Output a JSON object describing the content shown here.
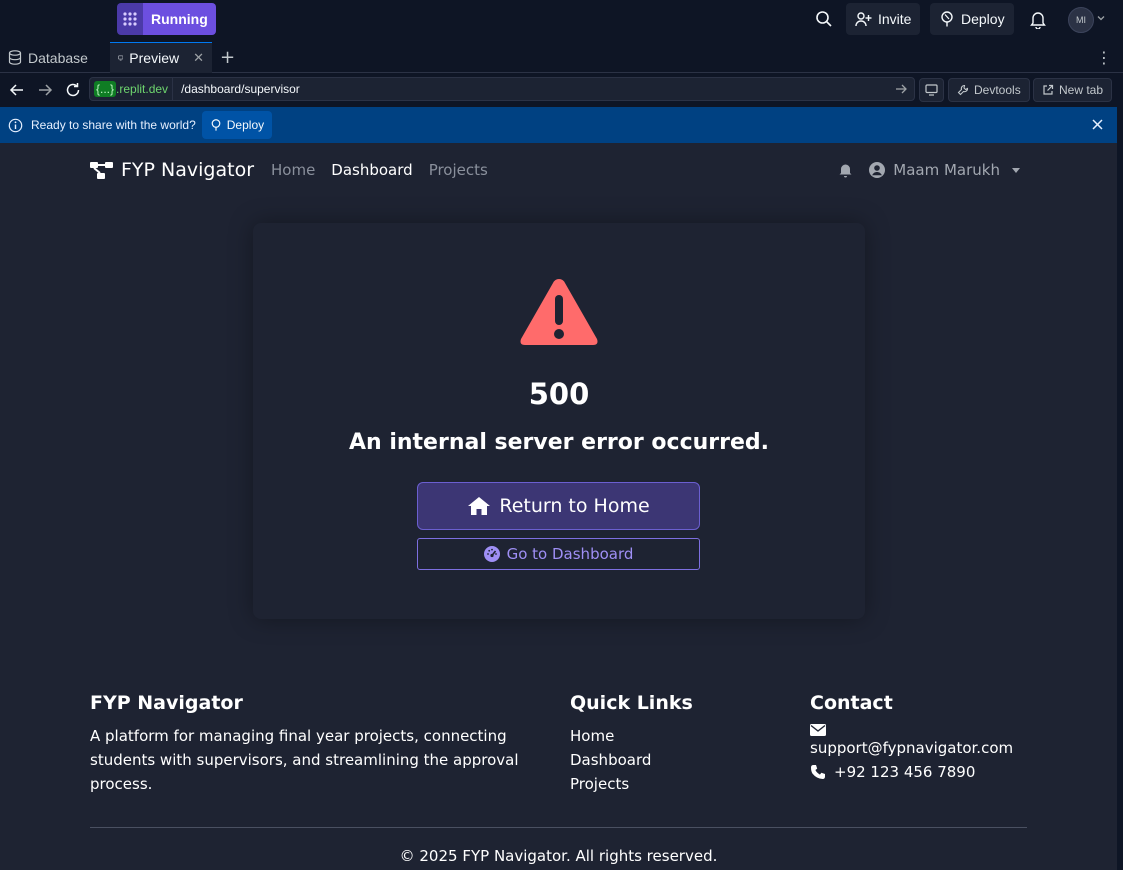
{
  "topbar": {
    "run_status": "Running",
    "invite_label": "Invite",
    "deploy_label": "Deploy",
    "avatar_initials": "MI"
  },
  "tabs": [
    {
      "label": "Database",
      "icon": "database-icon"
    },
    {
      "label": "Preview",
      "icon": "monitor-icon",
      "active": true
    }
  ],
  "urlbar": {
    "braces": "{...}",
    "host": ".replit.dev",
    "path": "/dashboard/supervisor",
    "devtools_label": "Devtools",
    "newtab_label": "New tab"
  },
  "banner": {
    "text": "Ready to share with the world?",
    "deploy_label": "Deploy"
  },
  "site": {
    "brand": "FYP Navigator",
    "nav": [
      "Home",
      "Dashboard",
      "Projects"
    ],
    "active_nav": "Dashboard",
    "user_name": "Maam Marukh"
  },
  "error": {
    "code": "500",
    "message": "An internal server error occurred.",
    "home_button": "Return to Home",
    "dashboard_button": "Go to Dashboard",
    "warning_color": "#ff6b6b"
  },
  "footer": {
    "about_title": "FYP Navigator",
    "about_text": "A platform for managing final year projects, connecting students with supervisors, and streamlining the approval process.",
    "links_title": "Quick Links",
    "links": [
      "Home",
      "Dashboard",
      "Projects"
    ],
    "contact_title": "Contact",
    "email": "support@fypnavigator.com",
    "phone": "+92 123 456 7890",
    "copyright": "© 2025 FYP Navigator. All rights reserved."
  }
}
